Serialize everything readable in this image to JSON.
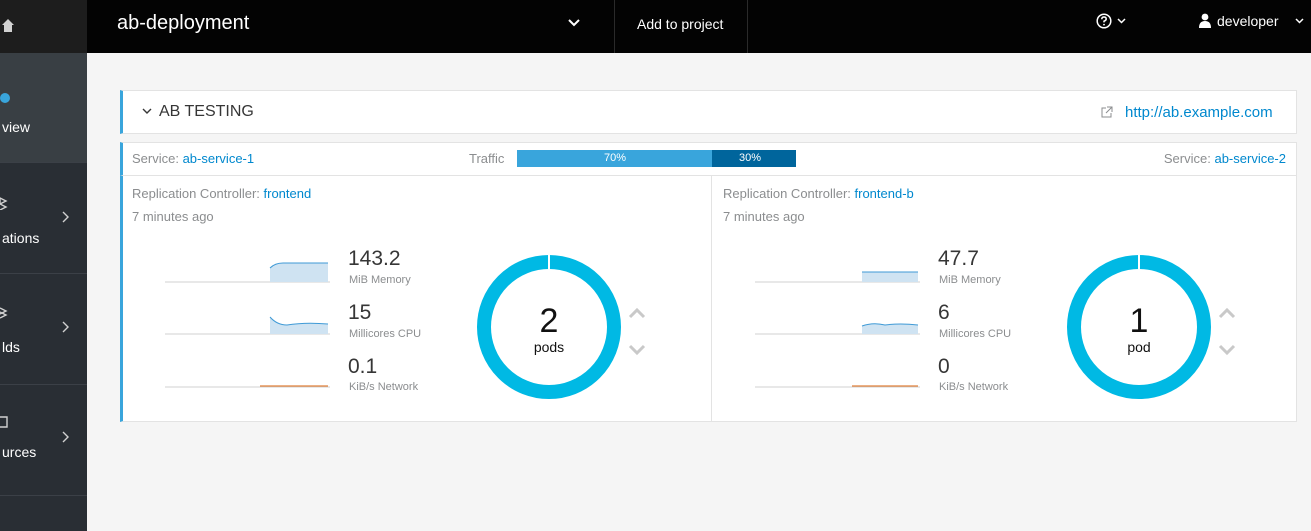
{
  "sidebar": {
    "items": [
      {
        "label": "view",
        "active": true,
        "icon": "dashboard-icon"
      },
      {
        "label": "ations",
        "icon": "applications-icon"
      },
      {
        "label": "lds",
        "icon": "builds-icon"
      },
      {
        "label": "urces",
        "icon": "resources-icon"
      }
    ]
  },
  "topbar": {
    "project_name": "ab-deployment",
    "add_to_project": "Add to project",
    "user": "developer"
  },
  "panel": {
    "title": "AB TESTING",
    "link": "http://ab.example.com",
    "traffic_label": "Traffic",
    "left": {
      "service_prefix": "Service: ",
      "service": "ab-service-1",
      "traffic_percent": "70%",
      "rc_prefix": "Replication Controller: ",
      "rc": "frontend",
      "ago": "7 minutes ago",
      "memory_value": "143.2",
      "memory_unit": "MiB Memory",
      "cpu_value": "15",
      "cpu_unit": "Millicores CPU",
      "network_value": "0.1",
      "network_unit": "KiB/s Network",
      "pods": "2",
      "pods_label": "pods"
    },
    "right": {
      "service_prefix": "Service: ",
      "service": "ab-service-2",
      "traffic_percent": "30%",
      "rc_prefix": "Replication Controller: ",
      "rc": "frontend-b",
      "ago": "7 minutes ago",
      "memory_value": "47.7",
      "memory_unit": "MiB Memory",
      "cpu_value": "6",
      "cpu_unit": "Millicores CPU",
      "network_value": "0",
      "network_unit": "KiB/s Network",
      "pods": "1",
      "pods_label": "pod"
    }
  },
  "colors": {
    "accent": "#39a5dc",
    "accent_dark": "#00659c",
    "link": "#0088ce",
    "donut": "#00b9e4"
  }
}
